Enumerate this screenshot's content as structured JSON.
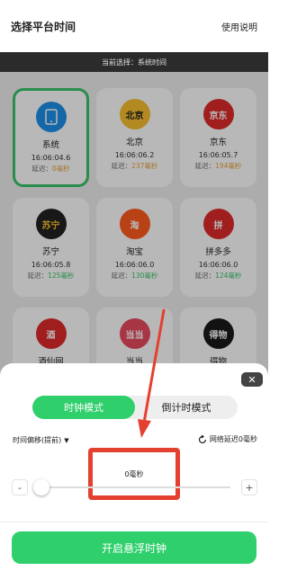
{
  "header": {
    "title": "选择平台时间",
    "help": "使用说明"
  },
  "current_bar": {
    "text": "当前选择：系统时间"
  },
  "delay_label": "延迟：",
  "platforms": [
    {
      "name": "系统",
      "time": "16:06:04.6",
      "delay": "0毫秒",
      "delay_color": "orange",
      "logo_text": "",
      "logo_bg": "#1e90e8",
      "logo_fg": "#ffffff",
      "icon": "phone-icon"
    },
    {
      "name": "北京",
      "time": "16:06:06.2",
      "delay": "237毫秒",
      "delay_color": "orange",
      "logo_text": "北京",
      "logo_bg": "#f7c02e",
      "logo_fg": "#222222",
      "icon": "beijing-logo-icon"
    },
    {
      "name": "京东",
      "time": "16:06:05.7",
      "delay": "194毫秒",
      "delay_color": "orange",
      "logo_text": "京东",
      "logo_bg": "#e02a2a",
      "logo_fg": "#ffffff",
      "icon": "jd-logo-icon"
    },
    {
      "name": "苏宁",
      "time": "16:06:05.8",
      "delay": "125毫秒",
      "delay_color": "green",
      "logo_text": "苏宁",
      "logo_bg": "#222222",
      "logo_fg": "#f7c02e",
      "icon": "suning-logo-icon"
    },
    {
      "name": "淘宝",
      "time": "16:06:06.0",
      "delay": "130毫秒",
      "delay_color": "green",
      "logo_text": "淘",
      "logo_bg": "#ff5a1f",
      "logo_fg": "#ffffff",
      "icon": "taobao-logo-icon"
    },
    {
      "name": "拼多多",
      "time": "16:06:06.0",
      "delay": "124毫秒",
      "delay_color": "green",
      "logo_text": "拼",
      "logo_bg": "#e02a2a",
      "logo_fg": "#ffffff",
      "icon": "pinduoduo-logo-icon"
    },
    {
      "name": "酒仙网",
      "time": "",
      "delay": "",
      "delay_color": "orange",
      "logo_text": "酒",
      "logo_bg": "#e02a2a",
      "logo_fg": "#ffffff",
      "icon": "jiuxian-logo-icon"
    },
    {
      "name": "当当",
      "time": "",
      "delay": "",
      "delay_color": "orange",
      "logo_text": "当当",
      "logo_bg": "#e84a5f",
      "logo_fg": "#ffffff",
      "icon": "dangdang-logo-icon"
    },
    {
      "name": "得物",
      "time": "",
      "delay": "",
      "delay_color": "orange",
      "logo_text": "得物",
      "logo_bg": "#1a1a1a",
      "logo_fg": "#ffffff",
      "icon": "dewu-logo-icon"
    }
  ],
  "sheet": {
    "mode_clock": "时钟模式",
    "mode_countdown": "倒计时模式",
    "offset_label": "时间偏移(提前)",
    "net_delay_label": "网络延迟0毫秒",
    "value_display": "0毫秒",
    "minus": "-",
    "plus": "+",
    "start_button": "开启悬浮时钟",
    "slider_value": 0,
    "close": "✕"
  },
  "colors": {
    "accent_green": "#2fcf6c",
    "highlight_red": "#e4402f",
    "delay_orange": "#e9a13b",
    "delay_green": "#3ac46a"
  }
}
